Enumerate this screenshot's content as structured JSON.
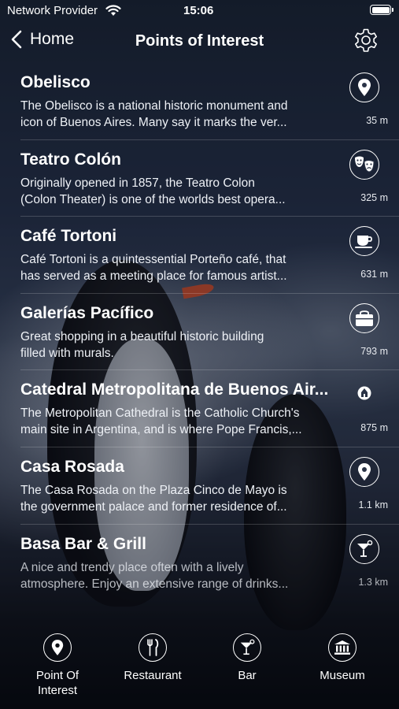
{
  "status_bar": {
    "carrier": "Network Provider",
    "time": "15:06"
  },
  "nav": {
    "back_label": "Home",
    "title": "Points of Interest"
  },
  "items": [
    {
      "title": "Obelisco",
      "desc1": "The Obelisco is a national historic monument and",
      "desc2": "icon of Buenos Aires. Many say it marks the ver...",
      "distance": "35 m",
      "icon": "map-pin-icon"
    },
    {
      "title": "Teatro Colón",
      "desc1": "Originally opened in 1857, the Teatro Colon",
      "desc2": "(Colon Theater) is one of the worlds best opera...",
      "distance": "325 m",
      "icon": "theater-masks-icon"
    },
    {
      "title": "Café Tortoni",
      "desc1": "Café Tortoni is a quintessential Porteño café, that",
      "desc2": "has served as a meeting place for famous artist...",
      "distance": "631 m",
      "icon": "coffee-cup-icon"
    },
    {
      "title": "Galerías Pacífico",
      "desc1": "Great shopping in a beautiful historic building",
      "desc2": "filled with murals.",
      "distance": "793 m",
      "icon": "shopping-bag-icon"
    },
    {
      "title": "Catedral Metropolitana de Buenos Air...",
      "desc1": "The Metropolitan Cathedral is the Catholic Church's",
      "desc2": "main site in Argentina, and is where Pope Francis,...",
      "distance": "875 m",
      "icon": "church-icon"
    },
    {
      "title": "Casa Rosada",
      "desc1": "The Casa Rosada on the Plaza Cinco de Mayo is",
      "desc2": "the government palace and former residence of...",
      "distance": "1.1 km",
      "icon": "map-pin-icon"
    },
    {
      "title": "Basa Bar & Grill",
      "desc1": "A nice and trendy place often with a lively",
      "desc2": "atmosphere. Enjoy an extensive range of drinks...",
      "distance": "1.3 km",
      "icon": "cocktail-icon"
    }
  ],
  "tabs": [
    {
      "label_line1": "Point Of",
      "label_line2": "Interest",
      "icon": "map-pin-icon"
    },
    {
      "label_line1": "Restaurant",
      "label_line2": "",
      "icon": "fork-knife-icon"
    },
    {
      "label_line1": "Bar",
      "label_line2": "",
      "icon": "cocktail-icon"
    },
    {
      "label_line1": "Museum",
      "label_line2": "",
      "icon": "museum-icon"
    }
  ]
}
